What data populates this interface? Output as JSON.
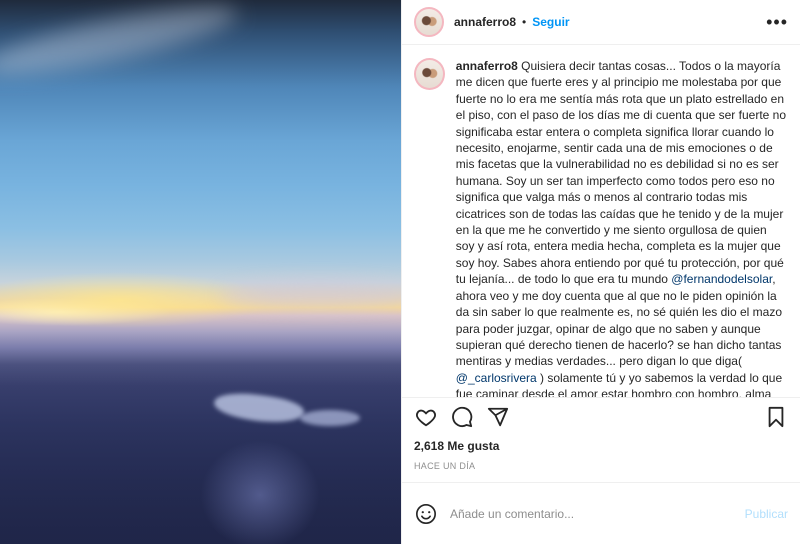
{
  "post": {
    "username": "annaferro8",
    "separator": "•",
    "follow_label": "Seguir",
    "more_icon": "more-options-icon"
  },
  "caption": {
    "username": "annaferro8",
    "text_part1": " Quisiera decir tantas cosas... Todos o la mayoría me dicen que fuerte eres y al principio me molestaba por que fuerte no lo era me sentía más rota que un plato estrellado en el piso, con el paso de los días me di cuenta que ser fuerte no significaba estar entera o completa significa llorar cuando lo necesito, enojarme, sentir cada una de mis emociones o de mis facetas que la vulnerabilidad no es debilidad si no es ser humana. Soy un ser tan imperfecto como todos pero eso no significa que valga más o menos al contrario todas mis cicatrices son de todas las caídas que he tenido y de la mujer en la que me he convertido y me siento orgullosa de quien soy y así rota, entera media hecha, completa es la mujer que soy hoy. Sabes ahora entiendo por qué tu protección, por qué tu lejanía... de todo lo que era tu mundo ",
    "mention1": "@fernandodelsolar",
    "text_part2": ", ahora veo y me doy cuenta que al que no le piden opinión la da sin saber lo que realmente es, no sé quién les dio el mazo para poder juzgar, opinar de algo que no saben y aunque supieran qué derecho tienen de hacerlo? se han dicho tantas mentiras y medias verdades... pero digan lo que diga( ",
    "mention2": "@_carlosrivera",
    "text_part3": " ) solamente tú y yo sabemos la verdad lo que fue caminar desde el amor estar hombro con hombro, alma con alma, ser con ser... tu me potenciaste a ser una mejor versión de mi gracias. Pensé y creí que la humanidad después de haber pasado por tanto dolor iban a ser más humanos, compasivos y amorosos y entender el dolor ajeno pero veo que no, la falta de"
  },
  "actions": {
    "like_icon": "heart-icon",
    "comment_icon": "comment-icon",
    "share_icon": "share-icon",
    "save_icon": "bookmark-icon"
  },
  "likes_text": "2,618 Me gusta",
  "time_text": "HACE UN DÍA",
  "comment_box": {
    "placeholder": "Añade un comentario...",
    "publish_label": "Publicar",
    "emoji_icon": "emoji-icon"
  },
  "colors": {
    "link_blue": "#0095f6",
    "mention": "#00376b",
    "publish_disabled": "#b2dffc"
  }
}
